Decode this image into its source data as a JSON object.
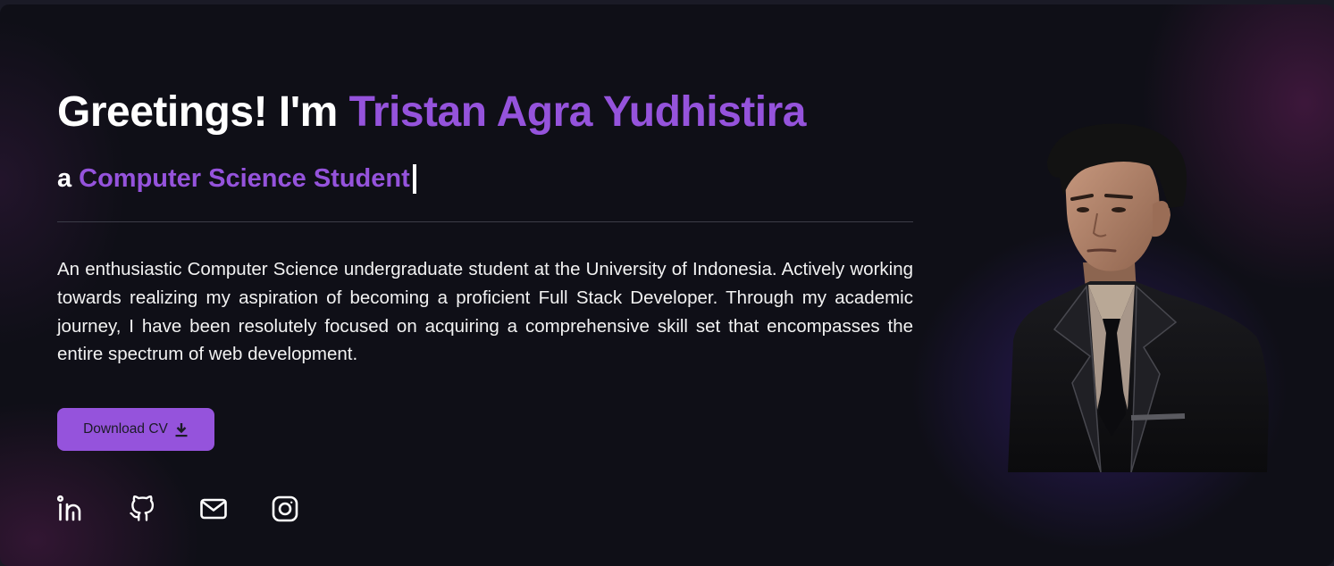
{
  "hero": {
    "greeting": "Greetings! I'm",
    "name": "Tristan Agra Yudhistira",
    "role_prefix": "a",
    "role": "Computer Science Student",
    "bio": "An enthusiastic Computer Science undergraduate student at the University of Indonesia. Actively working towards realizing my aspiration of becoming a proficient Full Stack Developer. Through my academic journey, I have been resolutely focused on acquiring a comprehensive skill set that encompasses the entire spectrum of web development.",
    "cv_button_label": "Download CV"
  },
  "socials": [
    {
      "icon": "linkedin-icon"
    },
    {
      "icon": "github-icon"
    },
    {
      "icon": "mail-icon"
    },
    {
      "icon": "instagram-icon"
    }
  ],
  "colors": {
    "accent": "#9553dc",
    "background": "#0f0f17",
    "text": "#ffffff"
  }
}
